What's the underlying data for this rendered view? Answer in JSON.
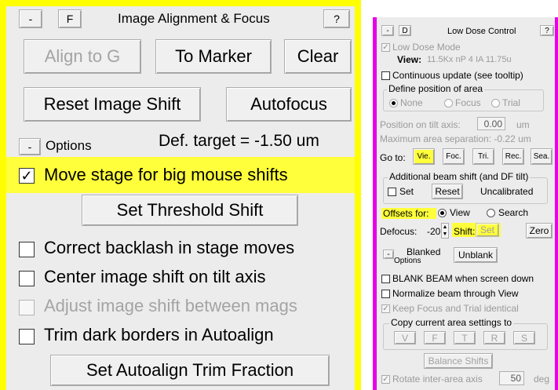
{
  "left": {
    "minimize_label": "-",
    "f_label": "F",
    "title": "Image Alignment & Focus",
    "help_label": "?",
    "align_to_g": "Align to G",
    "to_marker": "To Marker",
    "clear": "Clear",
    "reset_image_shift": "Reset Image Shift",
    "autofocus": "Autofocus",
    "options_toggle": "-",
    "options_label": "Options",
    "def_target": "Def. target = -1.50 um",
    "move_stage": {
      "label": "Move stage for big mouse shifts",
      "checked": "✓"
    },
    "set_threshold_shift": "Set Threshold Shift",
    "correct_backlash": "Correct backlash in stage moves",
    "center_image_shift": "Center image shift on tilt axis",
    "adjust_image_shift": "Adjust image shift between mags",
    "trim_dark": "Trim dark borders in Autoalign",
    "set_autoalign_trim": "Set Autoalign Trim Fraction"
  },
  "right": {
    "minimize_label": "-",
    "d_label": "D",
    "title": "Low Dose Control",
    "help_label": "?",
    "low_dose_mode": {
      "label": "Low Dose Mode",
      "checked": "✓"
    },
    "view_label": "View:",
    "view_params": "11.5Kx  nP 4  IA 11.75u",
    "continuous_update": "Continuous update (see tooltip)",
    "define_group": "Define position of area",
    "radio_none": "None",
    "radio_focus": "Focus",
    "radio_trial": "Trial",
    "position_label": "Position on tilt axis:",
    "position_value": "0.00",
    "position_unit": "um",
    "max_sep": "Maximum area separation:  -0.22 um",
    "goto_label": "Go to:",
    "goto_buttons": [
      "Vie.",
      "Foc.",
      "Tri.",
      "Rec.",
      "Sea."
    ],
    "beam_group": "Additional beam shift (and DF tilt)",
    "set_label": "Set",
    "reset_label": "Reset",
    "uncalibrated": "Uncalibrated",
    "offsets_label": "Offsets for:",
    "offsets_view": "View",
    "offsets_search": "Search",
    "defocus_label": "Defocus:",
    "defocus_value": "-20",
    "shift_label": "Shift:",
    "shift_set": "Set",
    "zero_label": "Zero",
    "options_toggle": "-",
    "options_label": "Options",
    "blanked_label": "Blanked",
    "unblank": "Unblank",
    "blank_beam": "BLANK BEAM when screen down",
    "normalize_beam": "Normalize beam through View",
    "keep_focus": {
      "label": "Keep Focus and Trial identical",
      "checked": "✓"
    },
    "copy_group": "Copy current area settings to",
    "copy_buttons": [
      "V",
      "F",
      "T",
      "R",
      "S"
    ],
    "balance_shifts": "Balance Shifts",
    "rotate_label": "Rotate inter-area axis",
    "rotate_value": "50",
    "rotate_unit": "deg",
    "rotate_checked": "✓"
  },
  "colors": {
    "highlight": "#ffff00",
    "magenta_border": "#e800e8",
    "goto_active": "#ffff3b"
  }
}
